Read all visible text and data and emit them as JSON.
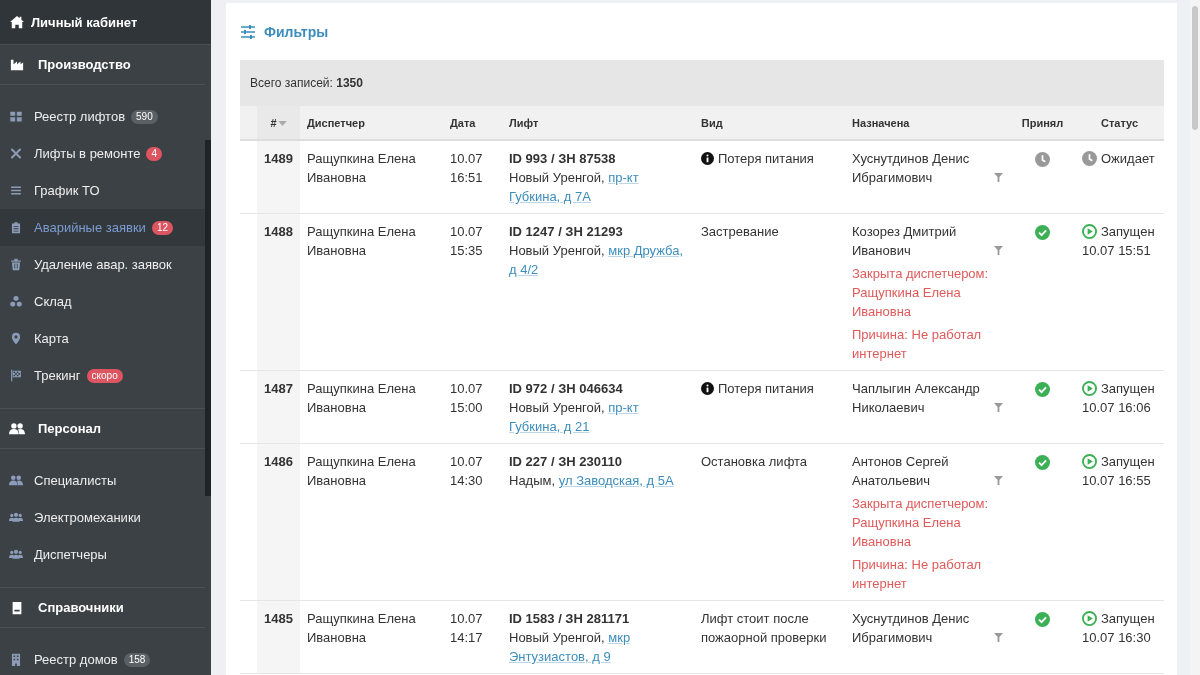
{
  "sidebar": {
    "header": "Личный кабинет",
    "sections": [
      {
        "title": "Производство",
        "items": [
          {
            "label": "Реестр лифтов",
            "badge": "590",
            "color": "#5a6064",
            "selected": false
          },
          {
            "label": "Лифты в ремонте",
            "badge": "4",
            "color": "#dd5561",
            "selected": false
          },
          {
            "label": "График ТО",
            "selected": false
          },
          {
            "label": "Аварийные заявки",
            "badge": "12",
            "color": "#dd5561",
            "selected": true
          },
          {
            "label": "Удаление авар. заявок",
            "selected": false
          },
          {
            "label": "Склад",
            "selected": false
          },
          {
            "label": "Карта",
            "selected": false
          },
          {
            "label": "Трекинг",
            "badge": "скоро",
            "color": "#dd5561",
            "selected": false
          }
        ]
      },
      {
        "title": "Персонал",
        "items": [
          {
            "label": "Специалисты",
            "selected": false
          },
          {
            "label": "Электромеханики",
            "selected": false
          },
          {
            "label": "Диспетчеры",
            "selected": false
          }
        ]
      },
      {
        "title": "Справочники",
        "items": [
          {
            "label": "Реестр домов",
            "badge": "158",
            "color": "#5a6064",
            "selected": false
          }
        ]
      }
    ]
  },
  "filters": {
    "title": "Фильтры"
  },
  "summary": "Всего записей: **1350**",
  "table": {
    "columns": [
      {
        "label": "#",
        "sorted": true
      },
      {
        "label": "Диспетчер",
        "sorted": false
      },
      {
        "label": "Дата",
        "sorted": false
      },
      {
        "label": "Лифт",
        "sorted": false
      },
      {
        "label": "Вид",
        "sorted": false
      },
      {
        "label": "Назначена",
        "sorted": false
      },
      {
        "label": "Принял",
        "sorted": false
      },
      {
        "label": "Статус",
        "sorted": false
      }
    ],
    "rows": [
      {
        "number": "1489",
        "dispatcher": "Ращупкина Елена Ивановна",
        "date": "10.07",
        "time": "16:51",
        "lift": "ID 993 / ЗН 87538",
        "city": "Новый Уренгой,",
        "address": "пр-кт Губкина, д 7А",
        "type": "Потеря питания",
        "info": true,
        "assigned": "Хуснутдинов Денис Ибрагимович",
        "accepted": false,
        "status": {
          "kind": "waiting",
          "label": "Ожидает"
        }
      },
      {
        "number": "1488",
        "dispatcher": "Ращупкина Елена Ивановна",
        "date": "10.07",
        "time": "15:35",
        "lift": "ID 1247 / ЗН 21293",
        "city": "Новый Уренгой,",
        "address": "мкр Дружба, д 4/2",
        "type": "Застревание",
        "assigned": "Козорез Дмитрий Иванович",
        "closed_by": "Закрыта диспетчером: Ращупкина Елена Ивановна",
        "reason": "Причина: Не работал интернет",
        "accepted": true,
        "status": {
          "kind": "running",
          "label": "Запущен",
          "time": "10.07 15:51"
        }
      },
      {
        "number": "1487",
        "dispatcher": "Ращупкина Елена Ивановна",
        "date": "10.07",
        "time": "15:00",
        "lift": "ID 972 / ЗН 046634",
        "city": "Новый Уренгой,",
        "address": "пр-кт Губкина, д 21",
        "type": "Потеря питания",
        "info": true,
        "assigned": "Чаплыгин Александр Николаевич",
        "accepted": true,
        "status": {
          "kind": "running",
          "label": "Запущен",
          "time": "10.07 16:06"
        }
      },
      {
        "number": "1486",
        "dispatcher": "Ращупкина Елена Ивановна",
        "date": "10.07",
        "time": "14:30",
        "lift": "ID 227 / ЗН 230110",
        "city": "Надым,",
        "address": "ул Заводская, д 5А",
        "type": "Остановка лифта",
        "assigned": "Антонов Сергей Анатольевич",
        "closed_by": "Закрыта диспетчером: Ращупкина Елена Ивановна",
        "reason": "Причина: Не работал интернет",
        "accepted": true,
        "status": {
          "kind": "running",
          "label": "Запущен",
          "time": "10.07 16:55"
        }
      },
      {
        "number": "1485",
        "dispatcher": "Ращупкина Елена Ивановна",
        "date": "10.07",
        "time": "14:17",
        "lift": "ID 1583 / ЗН 281171",
        "city": "Новый Уренгой,",
        "address": "мкр Энтузиастов, д 9",
        "type": "Лифт стоит после пожаорной проверки",
        "assigned": "Хуснутдинов Денис Ибрагимович",
        "accepted": true,
        "status": {
          "kind": "running",
          "label": "Запущен",
          "time": "10.07 16:30"
        }
      }
    ]
  }
}
